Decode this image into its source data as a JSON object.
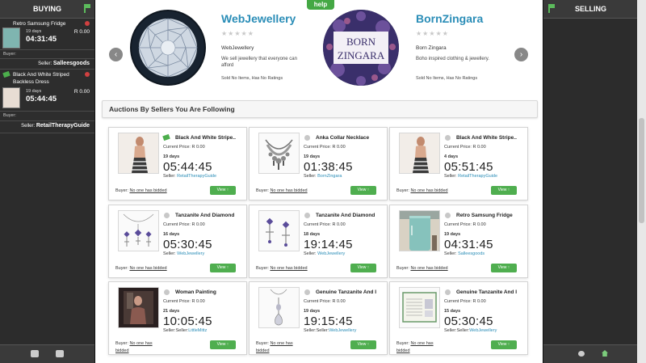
{
  "buying": {
    "title": "BUYING",
    "items": [
      {
        "title": "Retro Samsung Fridge",
        "days": "19 days",
        "time": "04:31:45",
        "price": "R 0.00",
        "buyer_label": "Buyer:",
        "seller_label": "Seller:",
        "seller": "Salleesgoods"
      },
      {
        "title": "Black And White Striped Backless Dress",
        "days": "19 days",
        "time": "05:44:45",
        "price": "R 0.00",
        "buyer_label": "Buyer:",
        "seller_label": "Seller:",
        "seller": "RetailTherapyGuide"
      }
    ]
  },
  "selling": {
    "title": "SELLING"
  },
  "help_label": "help",
  "shops": [
    {
      "name": "WebJewellery",
      "stars": "★★★★★",
      "subtitle": "WebJewellery",
      "description": "We sell jewellery that everyone can afford",
      "ratings": "Sold No Items, Has No Ratings"
    },
    {
      "name": "BornZingara",
      "stars": "★★★★★",
      "subtitle": "Born Zingara",
      "description": "Boho inspired clothing & jewellery.",
      "ratings": "Sold No Items, Has No Ratings",
      "logo_text_1": "BORN",
      "logo_text_2": "ZINGARA"
    }
  ],
  "carousel": {
    "prev": "‹",
    "next": "›"
  },
  "following_title": "Auctions By Sellers You Are Following",
  "view_label": "View ↑",
  "auctions": [
    {
      "title": "Black And White Stripe..",
      "price": "Current Price: R 0.00",
      "days": "19 days",
      "time": "05:44:45",
      "seller_label": "Seller: ",
      "seller": "RetailTherapyGuide",
      "buyer_label": "Buyer: ",
      "buyer": "No one has bidded"
    },
    {
      "title": "Anka Collar Necklace",
      "price": "Current Price: R 0.00",
      "days": "19 days",
      "time": "01:38:45",
      "seller_label": "Seller: ",
      "seller": "BornZingara",
      "buyer_label": "Buyer: ",
      "buyer": "No one has bidded"
    },
    {
      "title": "Black And White Stripe..",
      "price": "Current Price: R 0.00",
      "days": "4 days",
      "time": "05:51:45",
      "seller_label": "Seller: ",
      "seller": "RetailTherapyGuide",
      "buyer_label": "Buyer: ",
      "buyer": "No one has bidded"
    },
    {
      "title": "Tanzanite And Diamond",
      "price": "Current Price: R 0.00",
      "days": "16 days",
      "time": "05:30:45",
      "seller_label": "Seller: ",
      "seller": "WebJewellery",
      "buyer_label": "Buyer: ",
      "buyer": "No one has bidded"
    },
    {
      "title": "Tanzanite And Diamond",
      "price": "Current Price: R 0.00",
      "days": "18 days",
      "time": "19:14:45",
      "seller_label": "Seller: ",
      "seller": "WebJewellery",
      "buyer_label": "Buyer: ",
      "buyer": "No one has bidded"
    },
    {
      "title": "Retro Samsung Fridge",
      "price": "Current Price: R 0.00",
      "days": "19 days",
      "time": "04:31:45",
      "seller_label": "Seller: ",
      "seller": "Salleesgoods",
      "buyer_label": "Buyer: ",
      "buyer": "No one has bidded"
    },
    {
      "title": "Woman Painting",
      "price": "Current Price: R 0.00",
      "days": "21 days",
      "time": "10:05:45",
      "seller_label": "Seller:Seller:",
      "seller": "LittleMittz",
      "buyer_label": "Buyer: ",
      "buyer": "No one has bidded"
    },
    {
      "title": "Genuine Tanzanite And I",
      "price": "Current Price: R 0.00",
      "days": "19 days",
      "time": "19:15:45",
      "seller_label": "Seller:Seller:",
      "seller": "WebJewellery",
      "buyer_label": "Buyer: ",
      "buyer": "No one has bidded"
    },
    {
      "title": "Genuine Tanzanite And I",
      "price": "Current Price: R 0.00",
      "days": "15 days",
      "time": "05:30:45",
      "seller_label": "Seller:Seller:",
      "seller": "WebJewellery",
      "buyer_label": "Buyer: ",
      "buyer": "No one has bidded"
    }
  ],
  "colors": {
    "accent_green": "#4fae4f",
    "link_blue": "#2a8db7",
    "panel_dark": "#2c2c2c"
  }
}
